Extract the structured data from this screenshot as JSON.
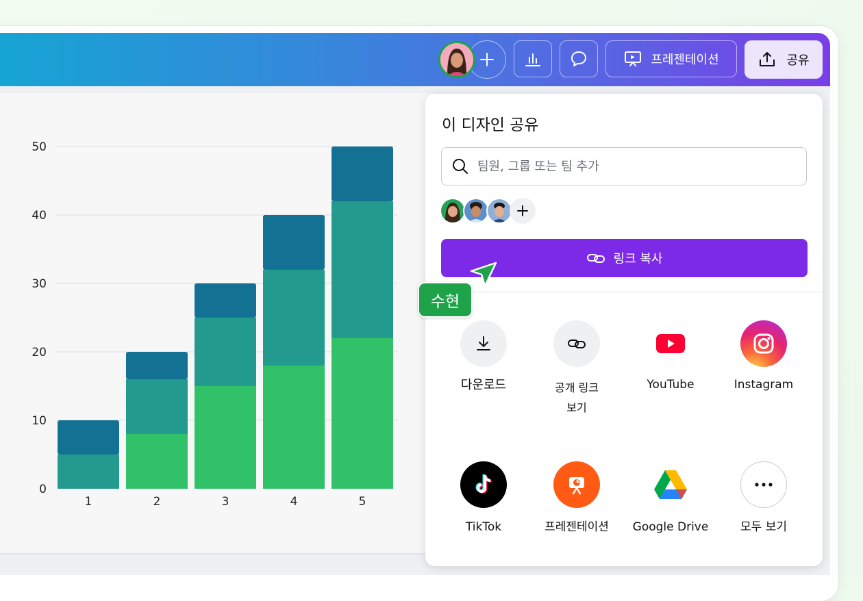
{
  "toolbar": {
    "present_label": "프레젠테이션",
    "share_label": "공유",
    "add_icon": "plus-icon",
    "analytics_icon": "bar-chart-icon",
    "comment_icon": "comment-icon"
  },
  "share_panel": {
    "title": "이 디자인 공유",
    "search_placeholder": "팀원, 그룹 또는 팀 추가",
    "copy_link_label": "링크 복사",
    "options": [
      {
        "label": "다운로드",
        "icon": "download-icon"
      },
      {
        "label": "공개 링크\n보기",
        "icon": "link-icon"
      },
      {
        "label": "YouTube",
        "icon": "youtube-icon"
      },
      {
        "label": "Instagram",
        "icon": "instagram-icon"
      },
      {
        "label": "TikTok",
        "icon": "tiktok-icon"
      },
      {
        "label": "프레젠테이션",
        "icon": "presentation-icon"
      },
      {
        "label": "Google Drive",
        "icon": "google-drive-icon"
      },
      {
        "label": "모두 보기",
        "icon": "more-icon"
      }
    ]
  },
  "collaborator": {
    "name": "수현",
    "color": "#1fa34a"
  },
  "colors": {
    "accent": "#7d2ae8",
    "series_dark": "#137293",
    "series_mid": "#229a8e",
    "series_light": "#31c269"
  },
  "chart_data": {
    "type": "bar",
    "stacked": true,
    "categories": [
      "1",
      "2",
      "3",
      "4",
      "5"
    ],
    "series": [
      {
        "values": [
          0,
          8,
          15,
          18,
          22
        ],
        "color": "#31c269"
      },
      {
        "values": [
          5,
          8,
          10,
          14,
          20
        ],
        "color": "#229a8e"
      },
      {
        "values": [
          5,
          4,
          5,
          8,
          8
        ],
        "color": "#137293"
      }
    ],
    "ylim": [
      0,
      50
    ],
    "yticks": [
      0,
      10,
      20,
      30,
      40,
      50
    ],
    "grid": true,
    "title": "",
    "xlabel": "",
    "ylabel": ""
  }
}
